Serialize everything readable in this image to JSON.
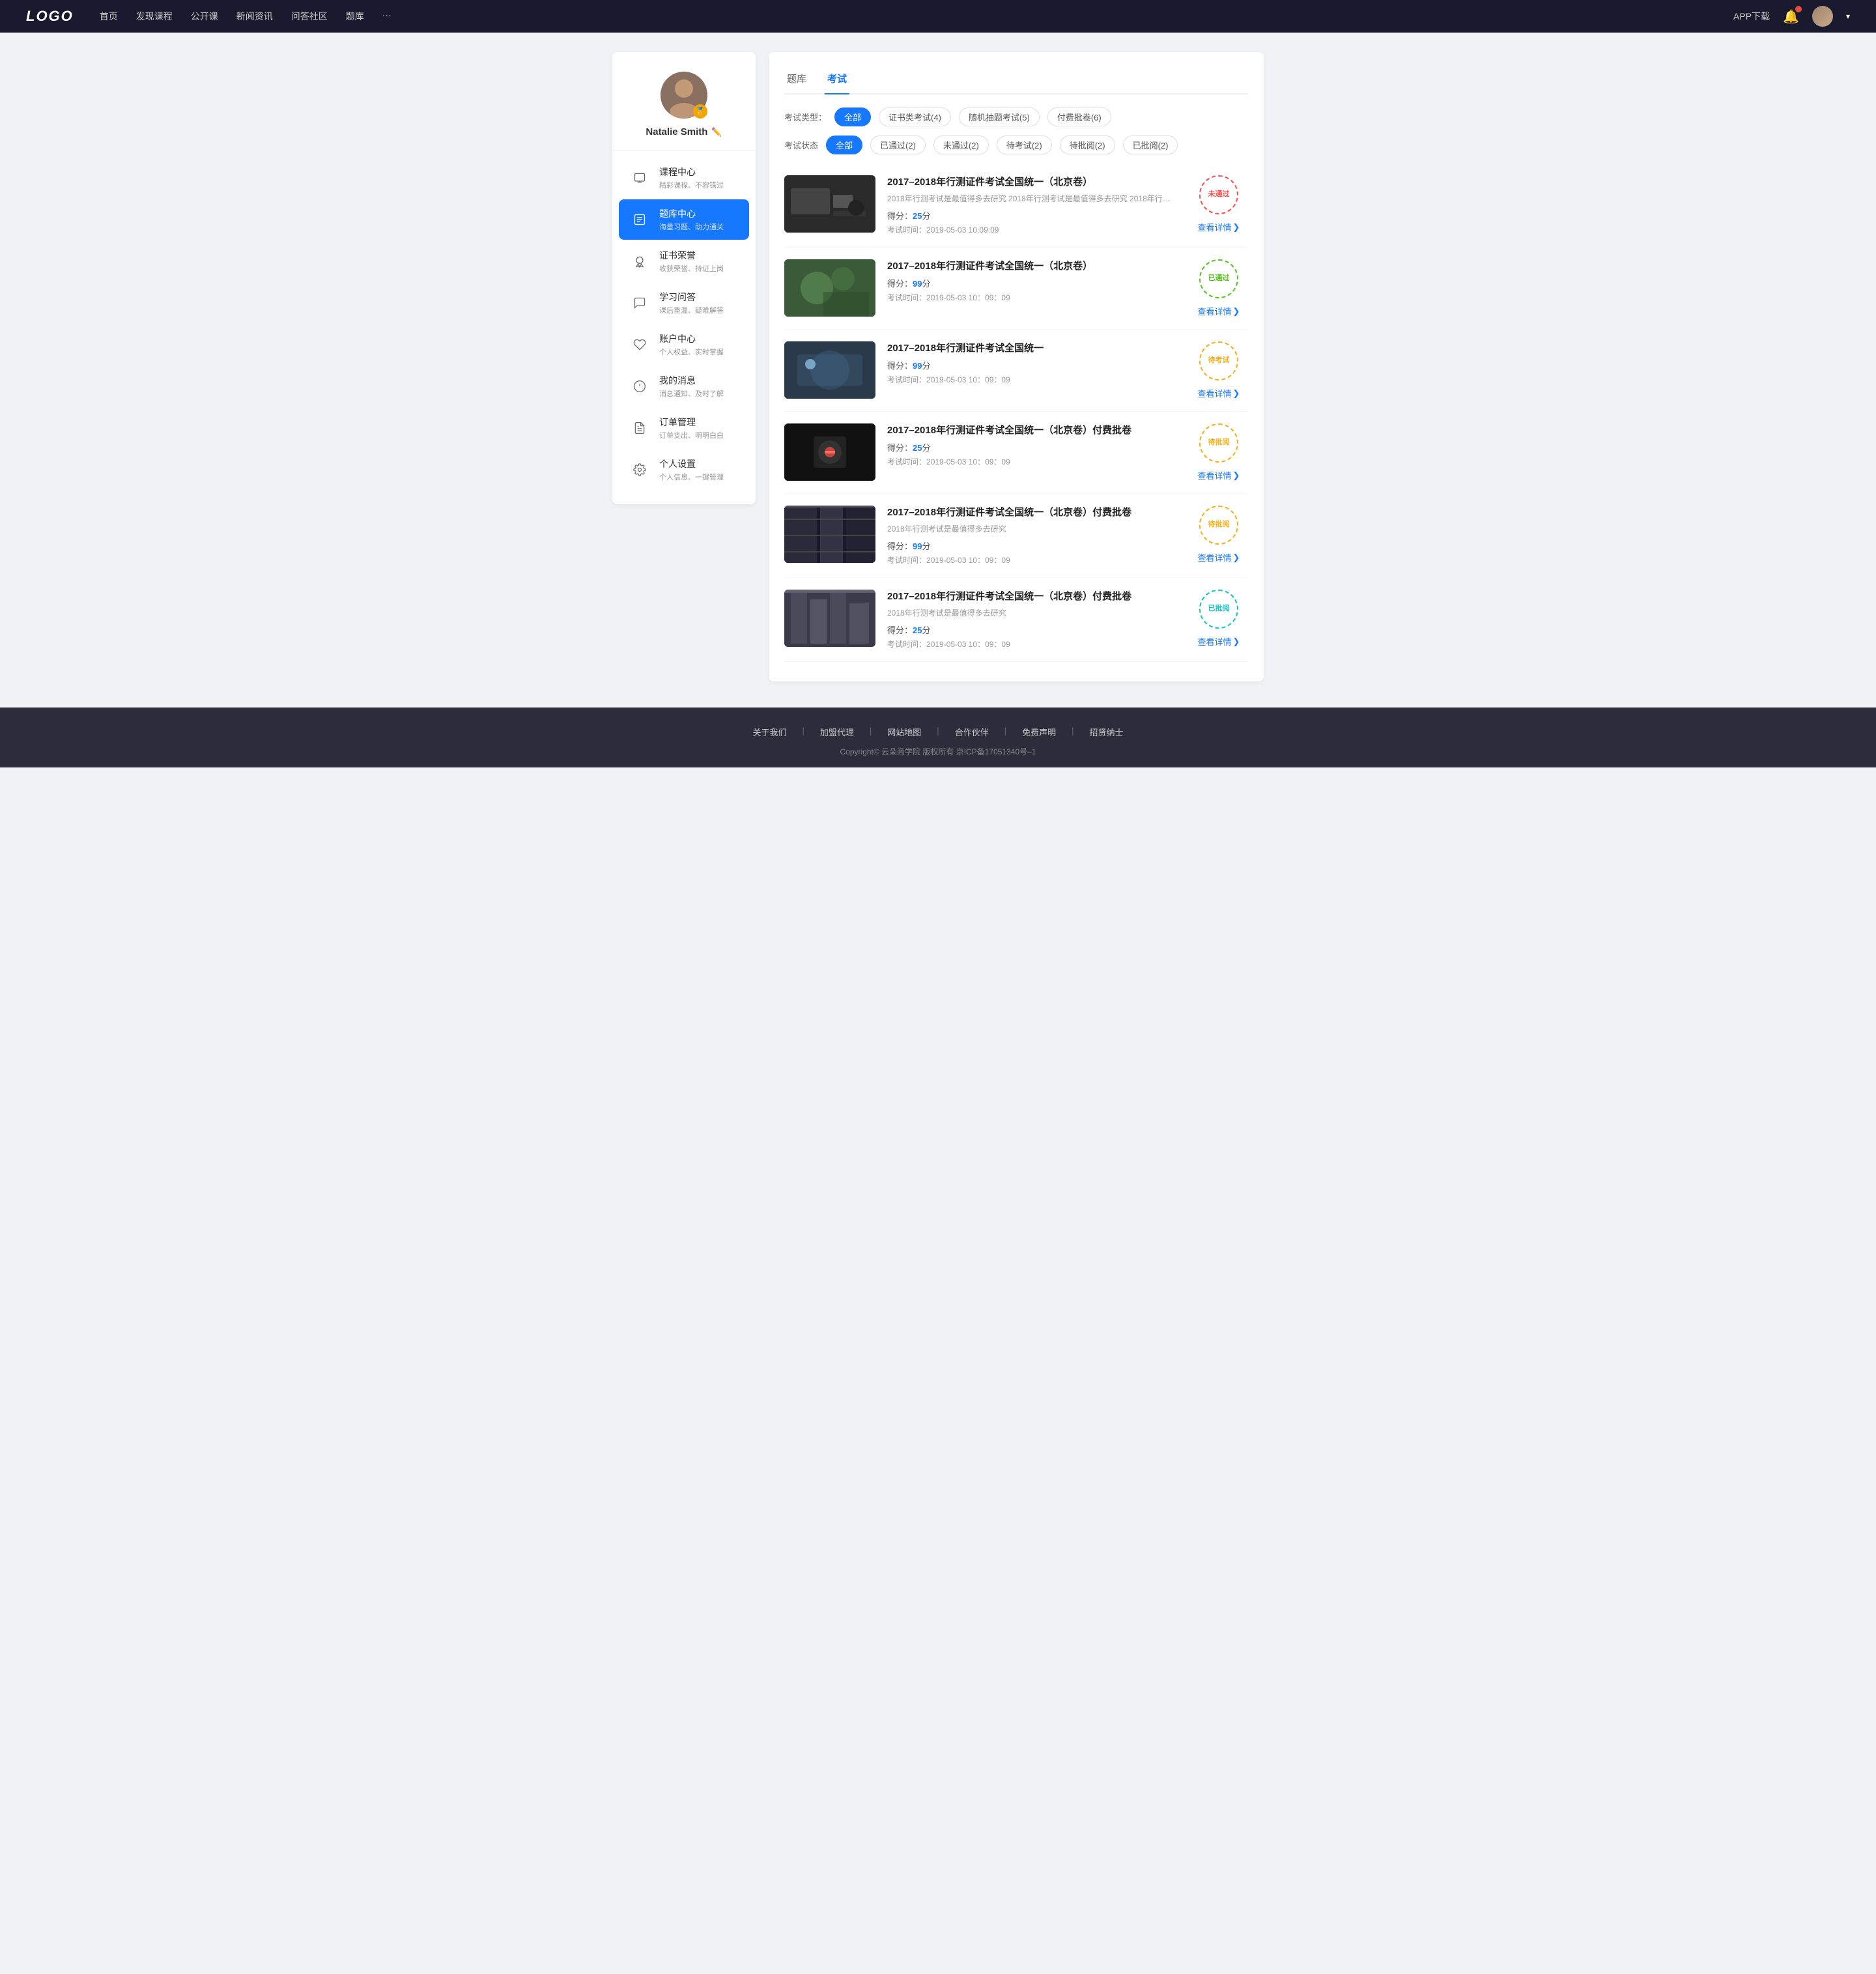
{
  "header": {
    "logo": "LOGO",
    "nav": [
      {
        "label": "首页",
        "id": "nav-home"
      },
      {
        "label": "发现课程",
        "id": "nav-discover"
      },
      {
        "label": "公开课",
        "id": "nav-opencourse"
      },
      {
        "label": "新闻资讯",
        "id": "nav-news"
      },
      {
        "label": "问答社区",
        "id": "nav-qa"
      },
      {
        "label": "题库",
        "id": "nav-bank"
      },
      {
        "label": "···",
        "id": "nav-more"
      }
    ],
    "app_btn": "APP下载"
  },
  "sidebar": {
    "profile": {
      "name": "Natalie Smith",
      "badge": "🏅"
    },
    "menu": [
      {
        "id": "course-center",
        "title": "课程中心",
        "sub": "精彩课程、不容错过",
        "active": false
      },
      {
        "id": "question-bank",
        "title": "题库中心",
        "sub": "海量习题、助力通关",
        "active": true
      },
      {
        "id": "certificates",
        "title": "证书荣誉",
        "sub": "收获荣誉、持证上岗",
        "active": false
      },
      {
        "id": "qa",
        "title": "学习问答",
        "sub": "课后重温、疑难解答",
        "active": false
      },
      {
        "id": "account",
        "title": "账户中心",
        "sub": "个人权益、实时掌握",
        "active": false
      },
      {
        "id": "messages",
        "title": "我的消息",
        "sub": "消息通知、及时了解",
        "active": false
      },
      {
        "id": "orders",
        "title": "订单管理",
        "sub": "订单支出、明明白白",
        "active": false
      },
      {
        "id": "settings",
        "title": "个人设置",
        "sub": "个人信息、一键管理",
        "active": false
      }
    ]
  },
  "content": {
    "main_tabs": [
      {
        "label": "题库",
        "id": "tab-bank",
        "active": false
      },
      {
        "label": "考试",
        "id": "tab-exam",
        "active": true
      }
    ],
    "exam_type_filter": {
      "label": "考试类型：",
      "options": [
        {
          "label": "全部",
          "active": true
        },
        {
          "label": "证书类考试(4)",
          "active": false
        },
        {
          "label": "随机抽题考试(5)",
          "active": false
        },
        {
          "label": "付费批卷(6)",
          "active": false
        }
      ]
    },
    "exam_status_filter": {
      "label": "考试状态",
      "options": [
        {
          "label": "全部",
          "active": true
        },
        {
          "label": "已通过(2)",
          "active": false
        },
        {
          "label": "未通过(2)",
          "active": false
        },
        {
          "label": "待考试(2)",
          "active": false
        },
        {
          "label": "待批阅(2)",
          "active": false
        },
        {
          "label": "已批阅(2)",
          "active": false
        }
      ]
    },
    "exam_list": [
      {
        "id": "exam-1",
        "title": "2017–2018年行测证件考试全国统一（北京卷）",
        "desc": "2018年行测考试是最值得多去研究 2018年行测考试是最值得多去研究 2018年行…",
        "score_label": "得分：",
        "score": "25",
        "score_unit": "分",
        "time_label": "考试时间：",
        "time": "2019-05-03  10:09:09",
        "status": "未通过",
        "status_class": "stamp-fail",
        "detail_link": "查看详情",
        "thumb_class": "thumb-1"
      },
      {
        "id": "exam-2",
        "title": "2017–2018年行测证件考试全国统一（北京卷）",
        "desc": "",
        "score_label": "得分：",
        "score": "99",
        "score_unit": "分",
        "time_label": "考试时间：",
        "time": "2019-05-03  10：09：09",
        "status": "已通过",
        "status_class": "stamp-pass",
        "detail_link": "查看详情",
        "thumb_class": "thumb-2"
      },
      {
        "id": "exam-3",
        "title": "2017–2018年行测证件考试全国统一",
        "desc": "",
        "score_label": "得分：",
        "score": "99",
        "score_unit": "分",
        "time_label": "考试时间：",
        "time": "2019-05-03  10：09：09",
        "status": "待考试",
        "status_class": "stamp-pending",
        "detail_link": "查看详情",
        "thumb_class": "thumb-3"
      },
      {
        "id": "exam-4",
        "title": "2017–2018年行测证件考试全国统一（北京卷）付费批卷",
        "desc": "",
        "score_label": "得分：",
        "score": "25",
        "score_unit": "分",
        "time_label": "考试时间：",
        "time": "2019-05-03  10：09：09",
        "status": "待批阅",
        "status_class": "stamp-pending",
        "detail_link": "查看详情",
        "thumb_class": "thumb-4"
      },
      {
        "id": "exam-5",
        "title": "2017–2018年行测证件考试全国统一（北京卷）付费批卷",
        "desc": "2018年行测考试是最值得多去研究",
        "score_label": "得分：",
        "score": "99",
        "score_unit": "分",
        "time_label": "考试时间：",
        "time": "2019-05-03  10：09：09",
        "status": "待批阅",
        "status_class": "stamp-pending",
        "detail_link": "查看详情",
        "thumb_class": "thumb-5"
      },
      {
        "id": "exam-6",
        "title": "2017–2018年行测证件考试全国统一（北京卷）付费批卷",
        "desc": "2018年行测考试是最值得多去研究",
        "score_label": "得分：",
        "score": "25",
        "score_unit": "分",
        "time_label": "考试时间：",
        "time": "2019-05-03  10：09：09",
        "status": "已批阅",
        "status_class": "stamp-reviewed",
        "detail_link": "查看详情",
        "thumb_class": "thumb-6"
      }
    ]
  },
  "footer": {
    "links": [
      {
        "label": "关于我们"
      },
      {
        "label": "加盟代理"
      },
      {
        "label": "网站地图"
      },
      {
        "label": "合作伙伴"
      },
      {
        "label": "免费声明"
      },
      {
        "label": "招贤纳士"
      }
    ],
    "copyright": "Copyright© 云朵商学院  版权所有    京ICP备17051340号–1"
  }
}
